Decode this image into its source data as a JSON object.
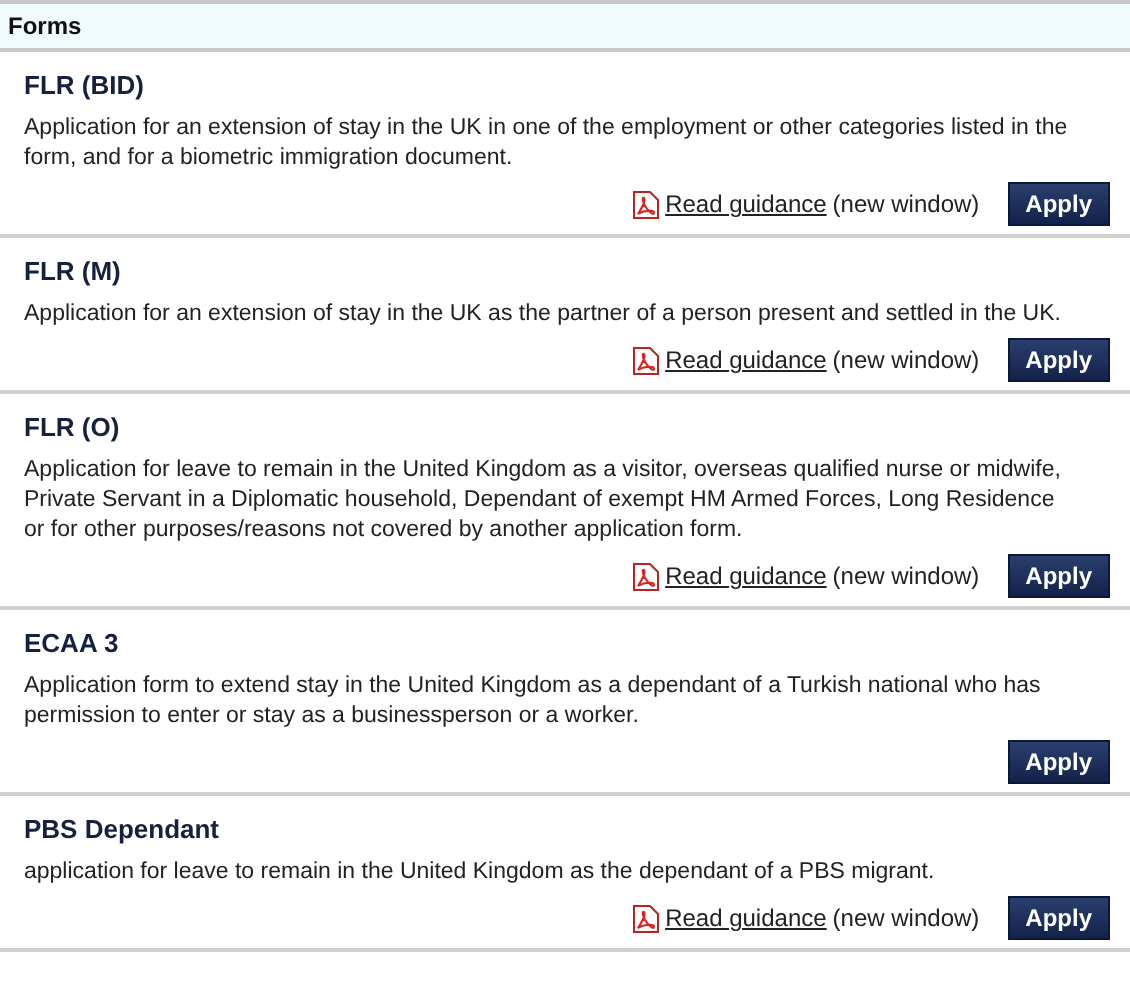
{
  "heading": "Forms",
  "forms": [
    {
      "title": "FLR (BID)",
      "description": "Application for an extension of stay in the UK in one of the employment or other categories listed in the form, and for a biometric immigration document.",
      "guidance": {
        "link": "Read guidance",
        "note": "(new window)"
      },
      "button": "Apply"
    },
    {
      "title": "FLR (M)",
      "description": "Application for an extension of stay in the UK as the partner of a person present and settled in the UK.",
      "guidance": {
        "link": "Read guidance",
        "note": "(new window)"
      },
      "button": "Apply"
    },
    {
      "title": "FLR (O)",
      "description": "Application for leave to remain in the United Kingdom as a visitor, overseas qualified nurse or midwife, Private Servant in a Diplomatic household, Dependant of exempt HM Armed Forces, Long Residence or for other purposes/reasons not covered by another application form.",
      "guidance": {
        "link": "Read guidance",
        "note": "(new window)"
      },
      "button": "Apply"
    },
    {
      "title": "ECAA 3",
      "description": "Application form to extend stay in the United Kingdom as a dependant of a Turkish national who has permission to enter or stay as a businessperson or a worker.",
      "button": "Apply"
    },
    {
      "title": "PBS Dependant",
      "description": "application for leave to remain in the United Kingdom as the dependant of a PBS migrant.",
      "guidance": {
        "link": "Read guidance",
        "note": "(new window)"
      },
      "button": "Apply"
    }
  ]
}
